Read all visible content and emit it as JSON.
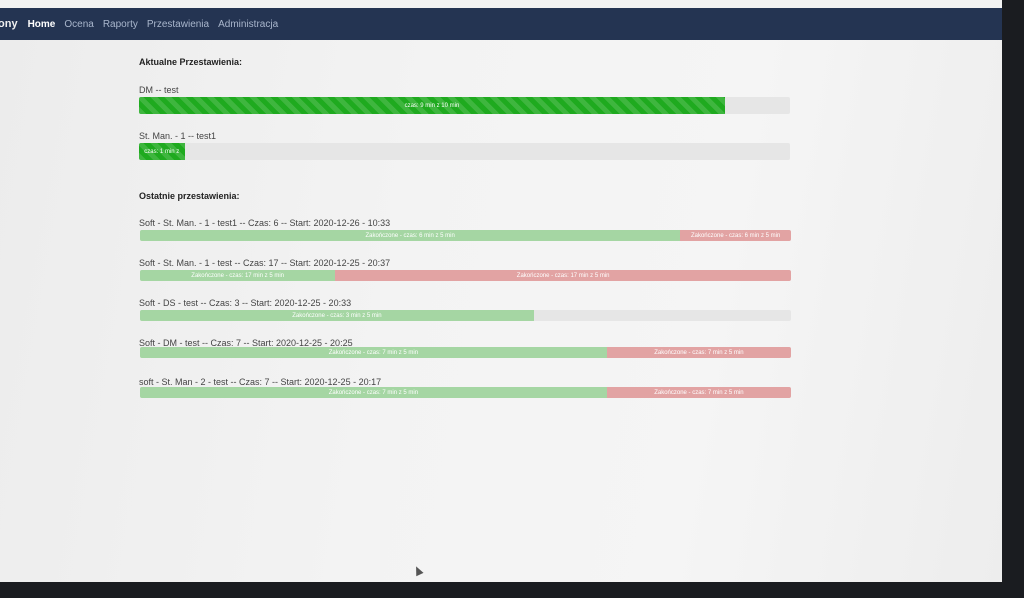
{
  "navbar": {
    "brand": "ony",
    "links": [
      "Home",
      "Ocena",
      "Raporty",
      "Przestawienia",
      "Administracja"
    ],
    "active": "Home"
  },
  "current": {
    "title": "Aktualne Przestawienia:",
    "items": [
      {
        "label": "DM -- test",
        "bar_text": "czas: 9 min z 10 min",
        "progress": 0.9
      },
      {
        "label": "St. Man. - 1 -- test1",
        "bar_text": "czas: 1 min z",
        "progress": 0.07
      }
    ]
  },
  "recent": {
    "title": "Ostatnie przestawienia:",
    "items": [
      {
        "label": "Soft - St. Man. - 1 - test1 -- Czas: 6 -- Start: 2020-12-26 - 10:33",
        "segments": [
          {
            "type": "green",
            "text": "Zakończone - czas: 6 min z 5 min",
            "fraction": 0.83
          },
          {
            "type": "red",
            "text": "Zakończone - czas: 6 min z 5 min",
            "fraction": 0.17
          }
        ]
      },
      {
        "label": "Soft - St. Man. - 1 - test -- Czas: 17 -- Start: 2020-12-25 - 20:37",
        "segments": [
          {
            "type": "green",
            "text": "Zakończone - czas: 17 min z 5 min",
            "fraction": 0.3
          },
          {
            "type": "red",
            "text": "Zakończone - czas: 17 min z 5 min",
            "fraction": 0.7
          }
        ]
      },
      {
        "label": "Soft - DS - test -- Czas: 3 -- Start: 2020-12-25 - 20:33",
        "segments": [
          {
            "type": "green",
            "text": "Zakończone - czas: 3 min z 5 min",
            "fraction": 0.6
          }
        ]
      },
      {
        "label": "Soft - DM - test -- Czas: 7 -- Start: 2020-12-25 - 20:25",
        "segments": [
          {
            "type": "green",
            "text": "Zakończone - czas: 7 min z 5 min",
            "fraction": 0.71
          },
          {
            "type": "red",
            "text": "Zakończone - czas: 7 min z 5 min",
            "fraction": 0.29
          }
        ]
      },
      {
        "label": "soft - St. Man - 2 - test -- Czas: 7 -- Start: 2020-12-25 - 20:17",
        "segments": [
          {
            "type": "green",
            "text": "Zakończone - czas: 7 min z 5 min",
            "fraction": 0.71
          },
          {
            "type": "red",
            "text": "Zakończone - czas: 7 min z 5 min",
            "fraction": 0.29
          }
        ]
      }
    ]
  },
  "colors": {
    "navbar": "#243452",
    "active_bar": "#1faa1f",
    "done_green": "#a5d6a3",
    "done_red": "#e2a3a3"
  }
}
